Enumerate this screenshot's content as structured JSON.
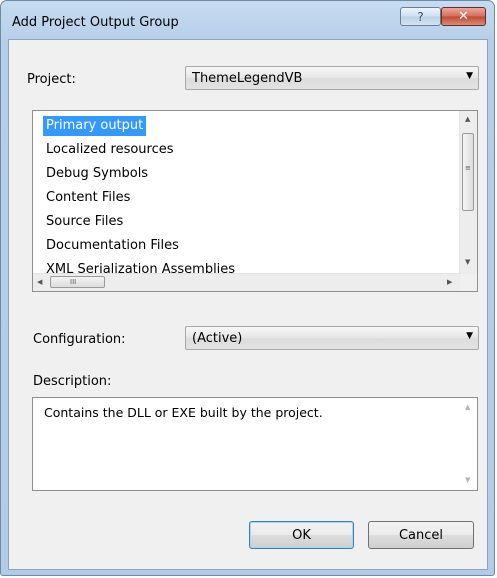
{
  "window": {
    "title": "Add Project Output Group",
    "help_glyph": "?",
    "close_glyph": "✕"
  },
  "project": {
    "label": "Project:",
    "value": "ThemeLegendVB",
    "dropdown_glyph": "▼"
  },
  "output_list": {
    "selected": "Primary output",
    "items": [
      "Primary output",
      "Localized resources",
      "Debug Symbols",
      "Content Files",
      "Source Files",
      "Documentation Files",
      "XML Serialization Assemblies"
    ],
    "scroll_up": "▲",
    "scroll_down": "▼",
    "scroll_left": "◀",
    "scroll_right": "▶",
    "grip_v": "≡",
    "grip_h": "III"
  },
  "configuration": {
    "label": "Configuration:",
    "value": "(Active)",
    "dropdown_glyph": "▼"
  },
  "description": {
    "label": "Description:",
    "text": "Contains the DLL or EXE built by the project.",
    "scroll_up": "▲",
    "scroll_down": "▼"
  },
  "buttons": {
    "ok": "OK",
    "cancel": "Cancel"
  },
  "colors": {
    "selection": "#3399ff",
    "frame": "#b6cfe9",
    "client": "#f0f0f0"
  }
}
